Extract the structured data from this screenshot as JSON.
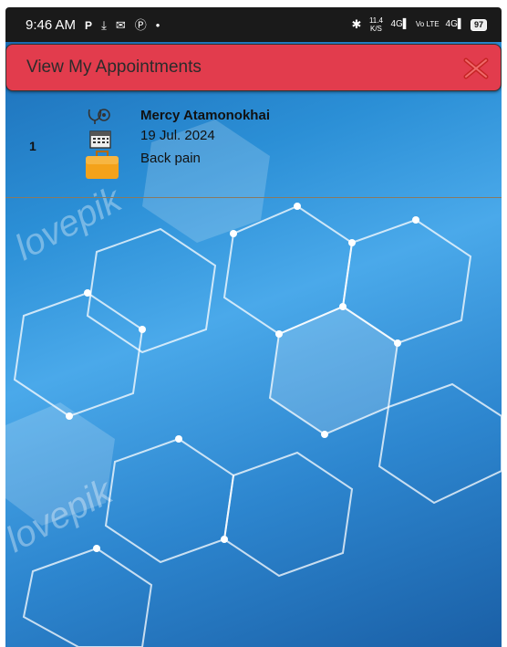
{
  "status_bar": {
    "time": "9:46 AM",
    "left_icons": [
      "P",
      "download-icon",
      "mail-icon",
      "pinterest-icon",
      "dot-icon"
    ],
    "network_speed": "11.4 K/S",
    "battery": "97"
  },
  "header": {
    "title": "View My Appointments",
    "close_icon": "close-icon",
    "color": "#e23c4d"
  },
  "appointments": [
    {
      "index": "1",
      "name": "Mercy Atamonokhai",
      "date": "19 Jul. 2024",
      "reason": "Back pain"
    }
  ]
}
